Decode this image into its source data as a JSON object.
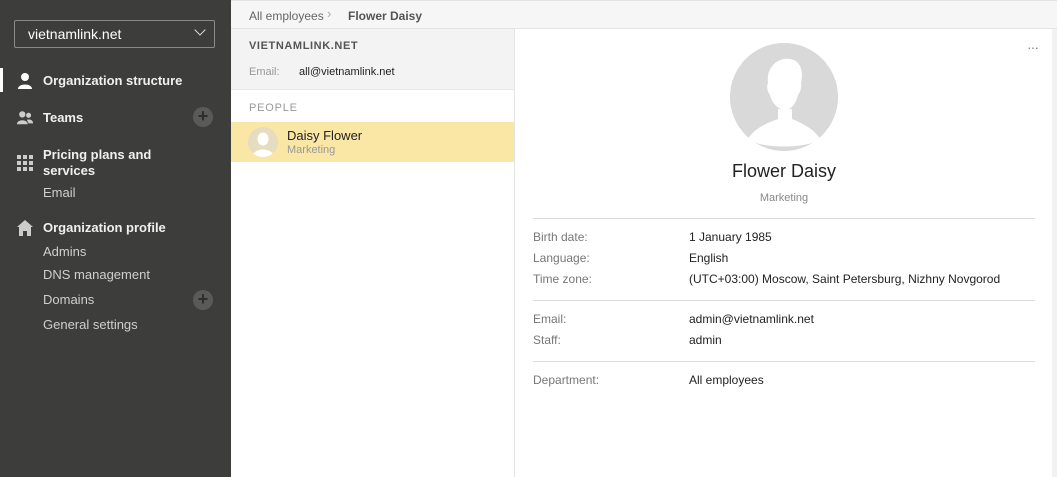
{
  "sidebar": {
    "org_selector": "vietnamlink.net",
    "items": [
      {
        "label": "Organization structure"
      },
      {
        "label": "Teams"
      },
      {
        "label": "Pricing plans and",
        "label2": "services"
      },
      {
        "label": "Organization profile"
      }
    ],
    "subitems_pricing": [
      "Email"
    ],
    "subitems_profile": [
      "Admins",
      "DNS management",
      "Domains",
      "General settings"
    ]
  },
  "breadcrumb": {
    "root": "All employees",
    "sep": "›",
    "current": "Flower Daisy"
  },
  "organization": {
    "name": "VIETNAMLINK.NET",
    "email_label": "Email:",
    "email": "all@vietnamlink.net"
  },
  "people": {
    "label": "PEOPLE",
    "list": [
      {
        "name": "Daisy Flower",
        "department": "Marketing"
      }
    ]
  },
  "profile": {
    "more": "···",
    "name": "Flower Daisy",
    "department": "Marketing",
    "fields": [
      {
        "label": "Birth date:",
        "value": "1 January 1985"
      },
      {
        "label": "Language:",
        "value": "English"
      },
      {
        "label": "Time zone:",
        "value": "(UTC+03:00) Moscow, Saint Petersburg, Nizhny Novgorod"
      },
      {
        "label": "Email:",
        "value": "admin@vietnamlink.net"
      },
      {
        "label": "Staff:",
        "value": "admin"
      },
      {
        "label": "Department:",
        "value": "All employees"
      }
    ]
  },
  "colors": {
    "sidebar_bg": "#3d3d3b",
    "selected_row": "#fbe7a5"
  }
}
